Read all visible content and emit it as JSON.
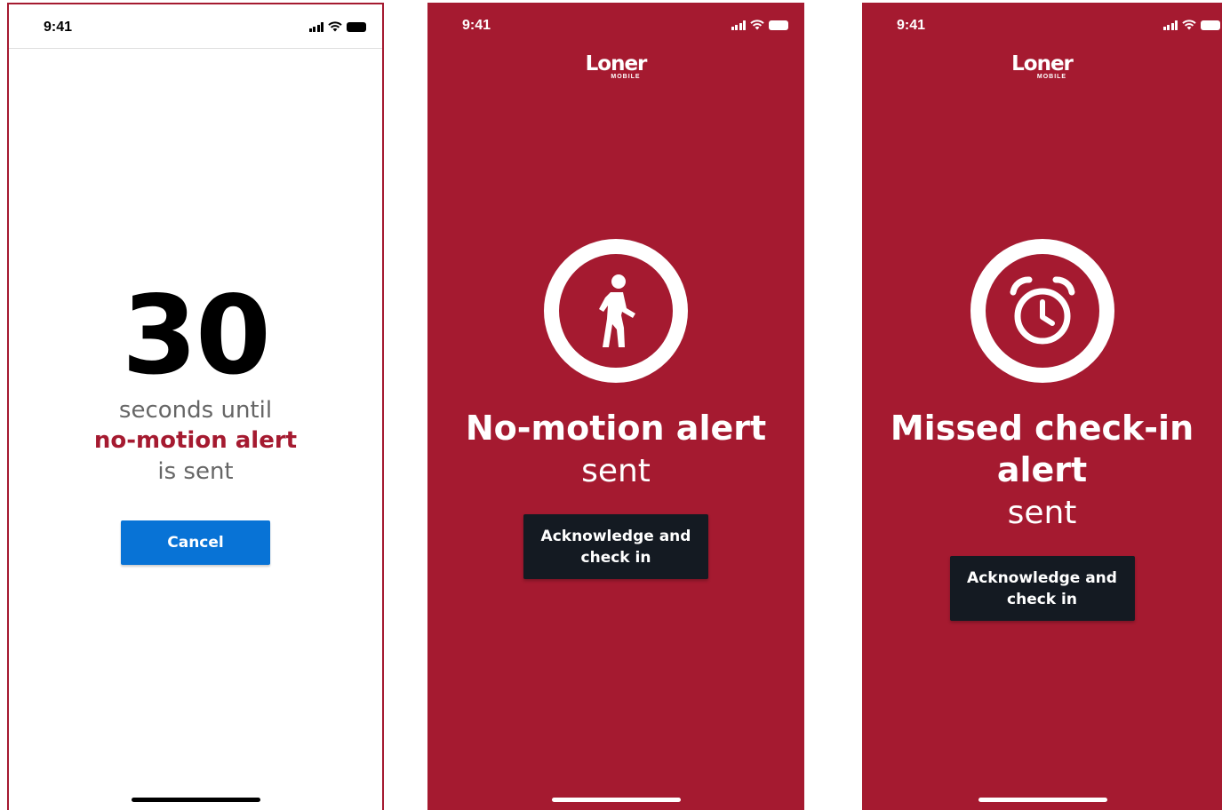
{
  "screens": [
    {
      "time": "9:41",
      "countdown": "30",
      "line1": "seconds until",
      "line2": "no-motion alert",
      "line3": "is sent",
      "cancel_label": "Cancel"
    },
    {
      "time": "9:41",
      "logo_main": "Loner",
      "logo_sub": "MOBILE",
      "icon": "walking-person-icon",
      "title": "No-motion alert",
      "subtitle": "sent",
      "button_line1": "Acknowledge and",
      "button_line2": "check in"
    },
    {
      "time": "9:41",
      "logo_main": "Loner",
      "logo_sub": "MOBILE",
      "icon": "alarm-clock-icon",
      "title_line1": "Missed check-in",
      "title_line2": "alert",
      "subtitle": "sent",
      "button_line1": "Acknowledge and",
      "button_line2": "check in"
    }
  ],
  "colors": {
    "brand_red": "#a51a30",
    "cancel_blue": "#0873d6",
    "button_dark": "#141a22"
  }
}
